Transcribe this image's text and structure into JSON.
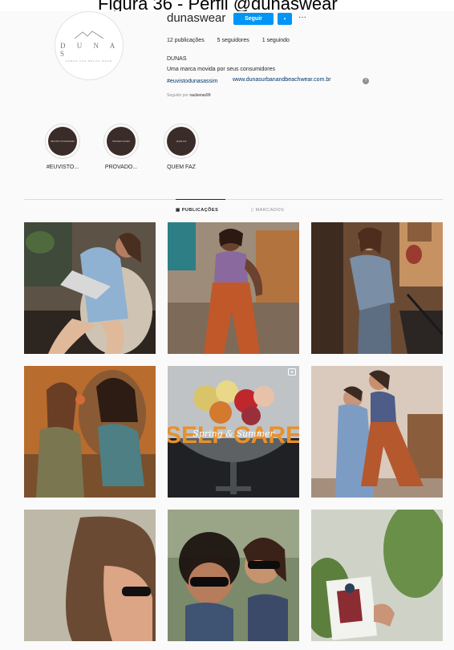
{
  "caption": "Figura 36 - Perfil @dunaswear",
  "profile": {
    "username": "dunaswear",
    "follow_label": "Seguir",
    "dropdown_glyph": "▾",
    "more_glyph": "···",
    "logo_text": "D U N A S",
    "logo_sub": "URBAN AND BEACH WEAR",
    "stats": {
      "posts": "12 publicações",
      "followers": "5 seguidores",
      "following": "1 seguindo"
    },
    "bio": {
      "name": "DUNAS",
      "description": "Uma marca movida por seus consumidores",
      "hashtag": "#euvistodunasassim",
      "link": "www.dunasurbanandbeachwear.com.br"
    },
    "followed_by_prefix": "Seguido por",
    "followed_by_user": "raulzeras99"
  },
  "highlights": [
    {
      "label": "#EUVISTO...",
      "cover_text": "#EUVISTO DUNASASSIM"
    },
    {
      "label": "PROVADO...",
      "cover_text": "PROVADO DUNAS"
    },
    {
      "label": "QUEM FAZ",
      "cover_text": "QUEM FAZ"
    }
  ],
  "tabs": {
    "posts": "▦ PUBLICAÇÕES",
    "tagged": "▯ MARCADOS"
  },
  "posts": [
    {
      "icon": "photo-icon"
    },
    {
      "icon": "photo-icon"
    },
    {
      "icon": "photo-icon"
    },
    {
      "icon": "photo-icon"
    },
    {
      "icon": "reel-icon",
      "overlay_text": "SELF CARE",
      "overlay_script": "Spring & Summer"
    },
    {
      "icon": "photo-icon"
    },
    {
      "icon": "photo-icon"
    },
    {
      "icon": "photo-icon"
    },
    {
      "icon": "photo-icon"
    }
  ],
  "colors": {
    "accent": "#0095f6",
    "link": "#00376b",
    "highlight_cover": "#3a2c28",
    "overlay_text": "#e8902b"
  }
}
